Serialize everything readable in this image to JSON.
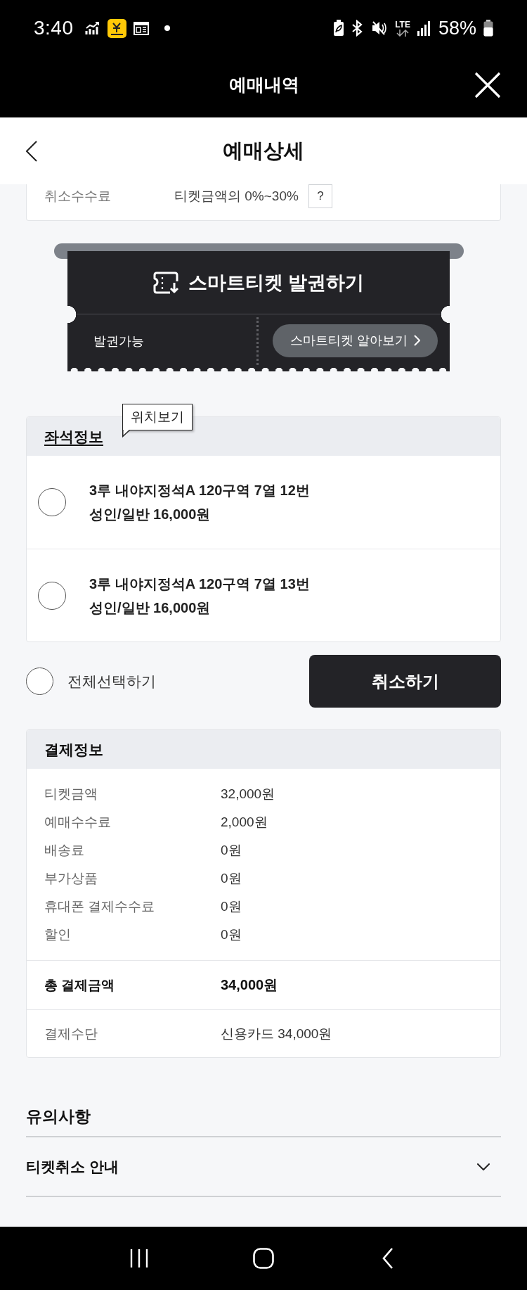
{
  "status_bar": {
    "time": "3:40",
    "network": "LTE",
    "battery": "58%"
  },
  "header": {
    "title": "예매내역"
  },
  "page": {
    "title": "예매상세"
  },
  "cancellation_fee": {
    "label": "취소수수료",
    "value": "티켓금액의 0%~30%",
    "help": "?"
  },
  "smart_ticket": {
    "title": "스마트티켓 발권하기",
    "status": "발권가능",
    "link": "스마트티켓 알아보기"
  },
  "seat_info": {
    "title": "좌석정보",
    "tooltip": "위치보기",
    "seats": [
      {
        "seat": "3루 내야지정석A 120구역 7열 12번",
        "price": "성인/일반 16,000원",
        "selected": false
      },
      {
        "seat": "3루 내야지정석A 120구역 7열 13번",
        "price": "성인/일반 16,000원",
        "selected": false
      }
    ]
  },
  "select_all": {
    "label": "전체선택하기",
    "checked": false
  },
  "cancel_button": "취소하기",
  "payment": {
    "title": "결제정보",
    "items": [
      {
        "label": "티켓금액",
        "value": "32,000원"
      },
      {
        "label": "예매수수료",
        "value": "2,000원"
      },
      {
        "label": "배송료",
        "value": "0원"
      },
      {
        "label": "부가상품",
        "value": "0원"
      },
      {
        "label": "휴대폰 결제수수료",
        "value": "0원"
      },
      {
        "label": "할인",
        "value": "0원"
      }
    ],
    "total": {
      "label": "총 결제금액",
      "value": "34,000원"
    },
    "method": {
      "label": "결제수단",
      "value": "신용카드 34,000원"
    }
  },
  "notes": {
    "title": "유의사항",
    "sections": [
      {
        "label": "티켓취소 안내",
        "expanded": false
      }
    ]
  }
}
